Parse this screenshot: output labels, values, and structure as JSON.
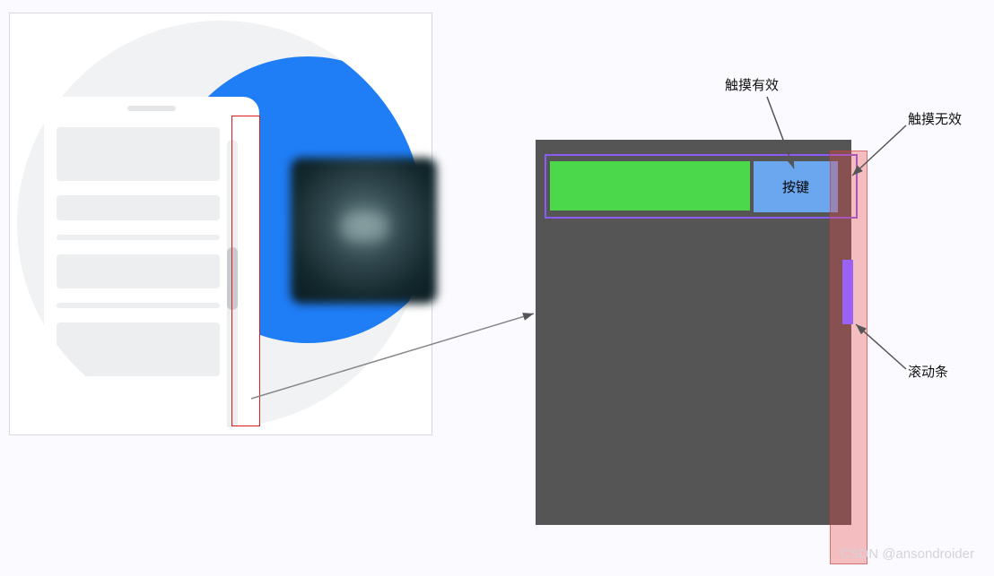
{
  "labels": {
    "valid_touch": "触摸有效",
    "invalid_touch": "触摸无效",
    "scrollbar": "滚动条",
    "button": "按键"
  },
  "watermark": "CSDN @ansondroider",
  "colors": {
    "gray_panel": "#555555",
    "green_bar": "#4bd94b",
    "blue_button": "#6aa7ee",
    "purple_frame": "#8b5cf6",
    "purple_thumb": "#9b63f5",
    "red_overlay": "rgba(231,75,75,0.35)",
    "blue_circle": "#1f7df6",
    "red_outline": "#e11b1b"
  }
}
